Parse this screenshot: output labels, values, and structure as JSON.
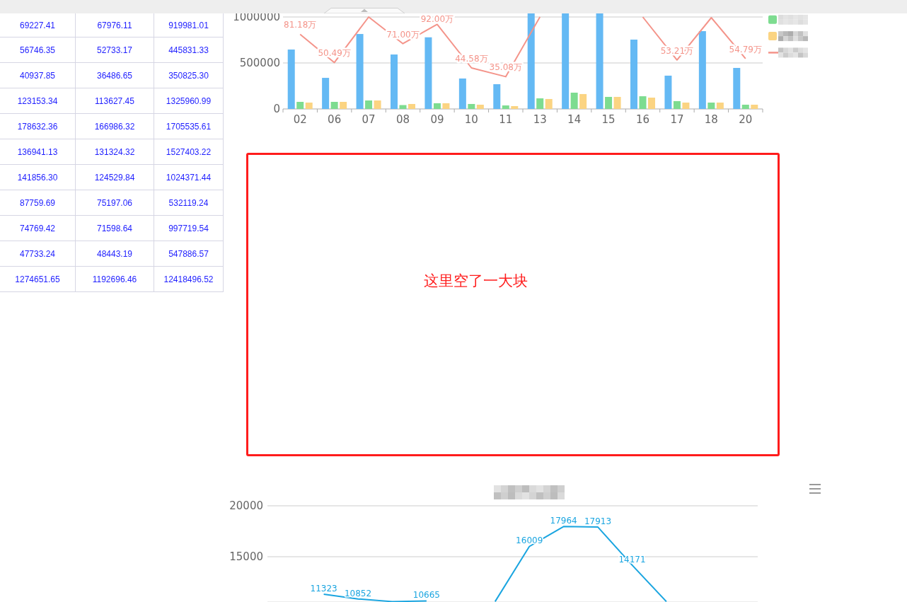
{
  "table": {
    "rows": [
      [
        "69227.41",
        "67976.11",
        "919981.01"
      ],
      [
        "56746.35",
        "52733.17",
        "445831.33"
      ],
      [
        "40937.85",
        "36486.65",
        "350825.30"
      ],
      [
        "123153.34",
        "113627.45",
        "1325960.99"
      ],
      [
        "178632.36",
        "166986.32",
        "1705535.61"
      ],
      [
        "136941.13",
        "131324.32",
        "1527403.22"
      ],
      [
        "141856.30",
        "124529.84",
        "1024371.44"
      ],
      [
        "87759.69",
        "75197.06",
        "532119.24"
      ],
      [
        "74769.42",
        "71598.64",
        "997719.54"
      ],
      [
        "47733.24",
        "48443.19",
        "547886.57"
      ],
      [
        "1274651.65",
        "1192696.46",
        "12418496.52"
      ]
    ]
  },
  "top_chart": {
    "legend_redacted": true,
    "chart_data": {
      "type": "bar",
      "categories": [
        "02",
        "06",
        "07",
        "08",
        "09",
        "10",
        "11",
        "13",
        "14",
        "15",
        "16",
        "17",
        "18",
        "20"
      ],
      "ylim": [
        0,
        1000000
      ],
      "yticks": [
        0,
        500000,
        1000000
      ],
      "series": [
        {
          "color": "#64b9f4",
          "values": [
            646000,
            338000,
            815000,
            592000,
            779000,
            331000,
            269000,
            1000000,
            1000000,
            1000000,
            754000,
            362000,
            846000,
            446000
          ]
        },
        {
          "color": "#7ddc90",
          "values": [
            77000,
            77000,
            92000,
            42000,
            62000,
            54000,
            38000,
            115000,
            177000,
            131000,
            138000,
            85000,
            69000,
            46000
          ]
        },
        {
          "color": "#fbd482",
          "values": [
            69000,
            77000,
            92000,
            54000,
            62000,
            46000,
            31000,
            108000,
            162000,
            131000,
            123000,
            69000,
            69000,
            46000
          ]
        },
        {
          "type": "line",
          "color": "#f4948a",
          "values": [
            811800,
            504900,
            1000000,
            710000,
            920000,
            445800,
            350800,
            1000000,
            null,
            null,
            1000000,
            532100,
            992000,
            547900
          ]
        }
      ],
      "annotations": [
        {
          "x": "02",
          "y": 811800,
          "text": "81.18万"
        },
        {
          "x": "06",
          "y": 504900,
          "text": "50.49万"
        },
        {
          "x": "08",
          "y": 710000,
          "text": "71.00万"
        },
        {
          "x": "09",
          "y": 920000,
          "text": "92.00万"
        },
        {
          "x": "10",
          "y": 445800,
          "text": "44.58万"
        },
        {
          "x": "11",
          "y": 350800,
          "text": "35.08万"
        },
        {
          "x": "17",
          "y": 532100,
          "text": "53.21万"
        },
        {
          "x": "20",
          "y": 547900,
          "text": "54.79万"
        }
      ]
    }
  },
  "annotation": {
    "text": "这里空了一大块"
  },
  "bottom_chart": {
    "title_redacted": true,
    "chart_data": {
      "type": "line",
      "ylim": [
        10600,
        20000
      ],
      "yticks": [
        15000,
        20000
      ],
      "series": [
        {
          "color": "#1aa5e0",
          "values": [
            null,
            11323,
            10852,
            10600,
            10665,
            null,
            10600,
            16009,
            17964,
            17913,
            14171,
            10600,
            null,
            null
          ],
          "value_labels": [
            null,
            "11323",
            "10852",
            null,
            "10665",
            null,
            null,
            "16009",
            "17964",
            "17913",
            "14171",
            null,
            null,
            null
          ]
        }
      ]
    }
  }
}
